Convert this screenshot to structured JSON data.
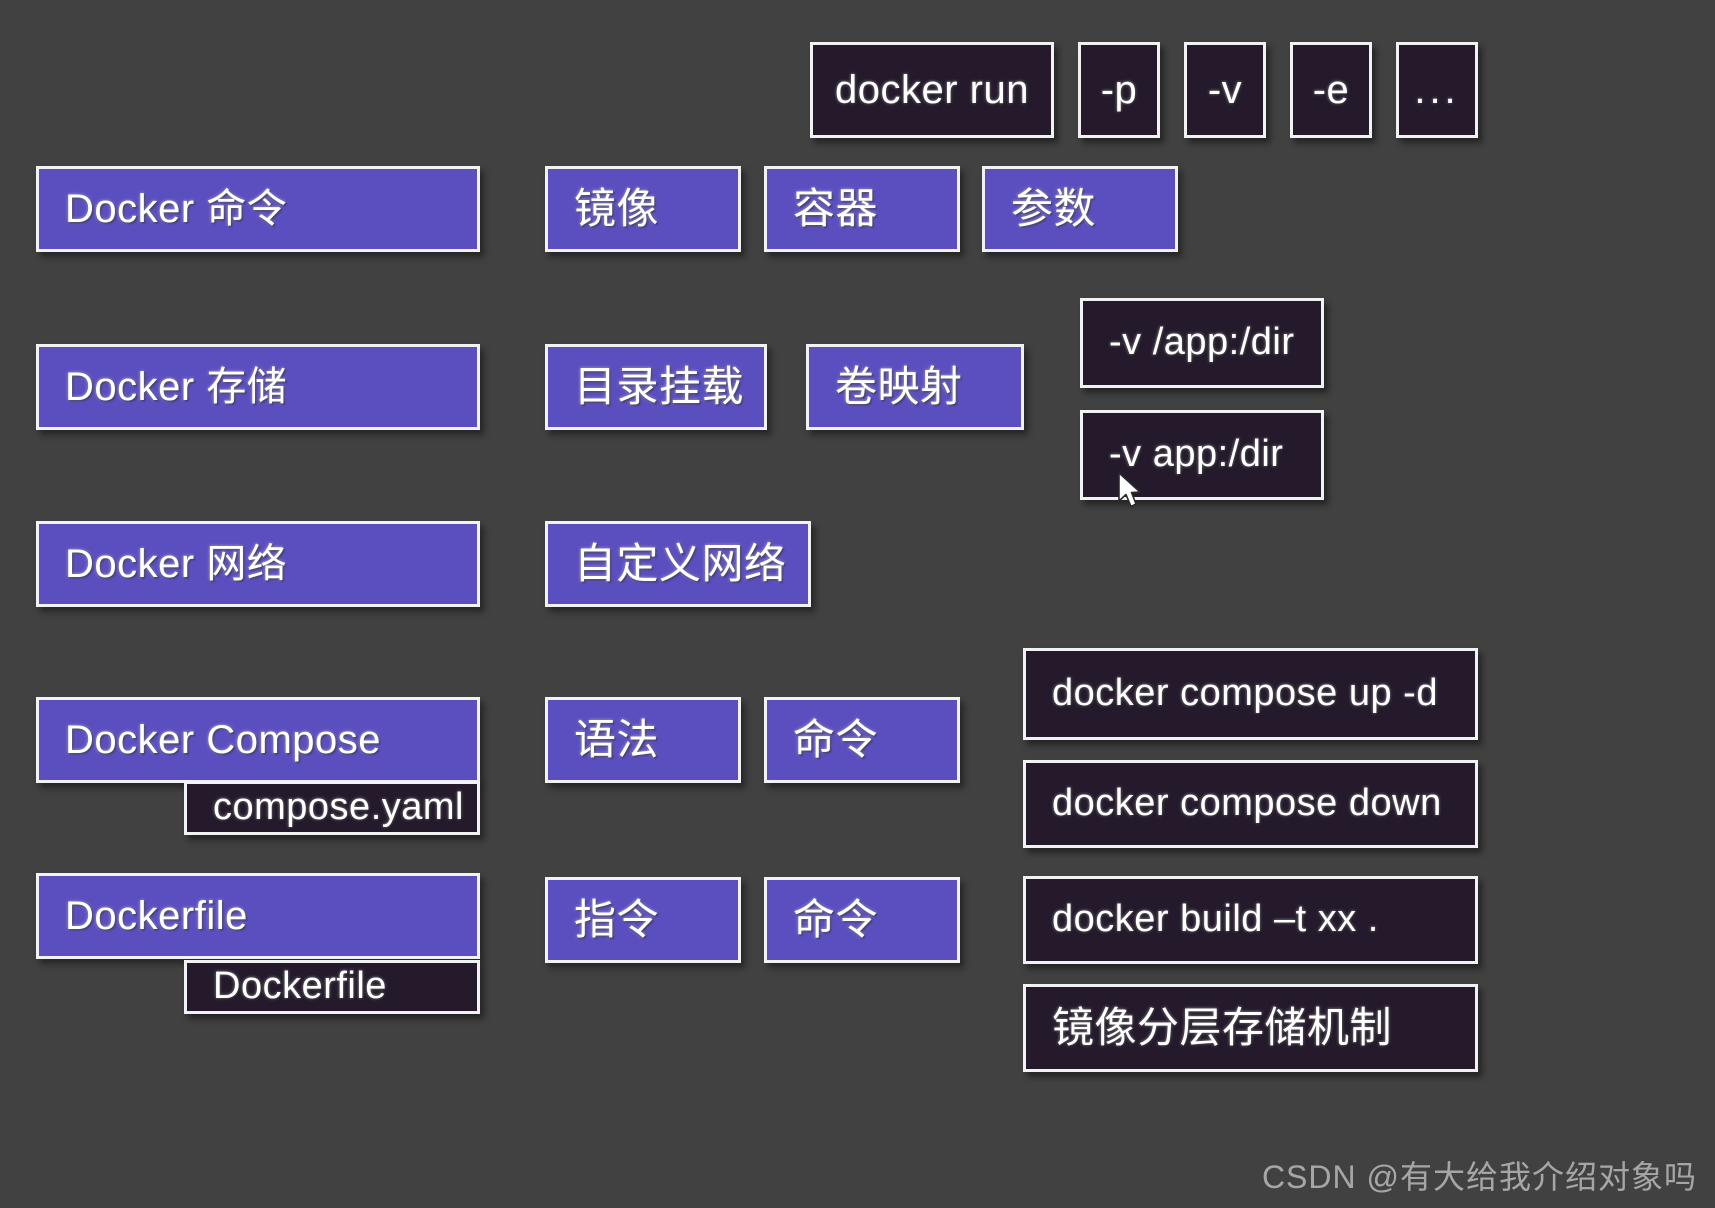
{
  "meta": {
    "background_color": "#414141",
    "accent_purple": "#5b4fc0",
    "accent_dark": "#241a2c",
    "border_color": "#f2f2f2",
    "text_color": "#ffffff"
  },
  "watermark": "CSDN @有大给我介绍对象吗",
  "diagram": {
    "title_nodes": [
      {
        "id": "docker-commands",
        "label": "Docker 命令"
      },
      {
        "id": "docker-storage",
        "label": "Docker 存储"
      },
      {
        "id": "docker-network",
        "label": "Docker 网络"
      },
      {
        "id": "docker-compose",
        "label": "Docker Compose"
      },
      {
        "id": "dockerfile",
        "label": "Dockerfile"
      }
    ],
    "row_commands": {
      "subtopics": [
        {
          "id": "image",
          "label": "镜像"
        },
        {
          "id": "container",
          "label": "容器"
        },
        {
          "id": "params",
          "label": "参数"
        }
      ],
      "command_chips": [
        {
          "id": "docker-run",
          "label": "docker run"
        },
        {
          "id": "flag-p",
          "label": "-p"
        },
        {
          "id": "flag-v",
          "label": "-v"
        },
        {
          "id": "flag-e",
          "label": "-e"
        },
        {
          "id": "flag-more",
          "label": "..."
        }
      ]
    },
    "row_storage": {
      "subtopics": [
        {
          "id": "dir-mount",
          "label": "目录挂载"
        },
        {
          "id": "vol-mapping",
          "label": "卷映射"
        }
      ],
      "examples": [
        {
          "id": "v-bind-mount",
          "label": "-v /app:/dir"
        },
        {
          "id": "v-volume",
          "label": "-v app:/dir"
        }
      ]
    },
    "row_network": {
      "subtopics": [
        {
          "id": "custom-network",
          "label": "自定义网络"
        }
      ]
    },
    "row_compose": {
      "file_badge": {
        "id": "compose-yaml",
        "label": "compose.yaml"
      },
      "subtopics": [
        {
          "id": "compose-syntax",
          "label": "语法"
        },
        {
          "id": "compose-commands",
          "label": "命令"
        }
      ],
      "examples": [
        {
          "id": "compose-up",
          "label": "docker compose up -d"
        },
        {
          "id": "compose-down",
          "label": "docker compose down"
        }
      ]
    },
    "row_dockerfile": {
      "file_badge": {
        "id": "dockerfile-badge",
        "label": "Dockerfile"
      },
      "subtopics": [
        {
          "id": "dockerfile-instructions",
          "label": "指令"
        },
        {
          "id": "dockerfile-commands",
          "label": "命令"
        }
      ],
      "examples": [
        {
          "id": "docker-build",
          "label": "docker build –t xx ."
        },
        {
          "id": "image-layering",
          "label": "镜像分层存储机制"
        }
      ]
    }
  }
}
